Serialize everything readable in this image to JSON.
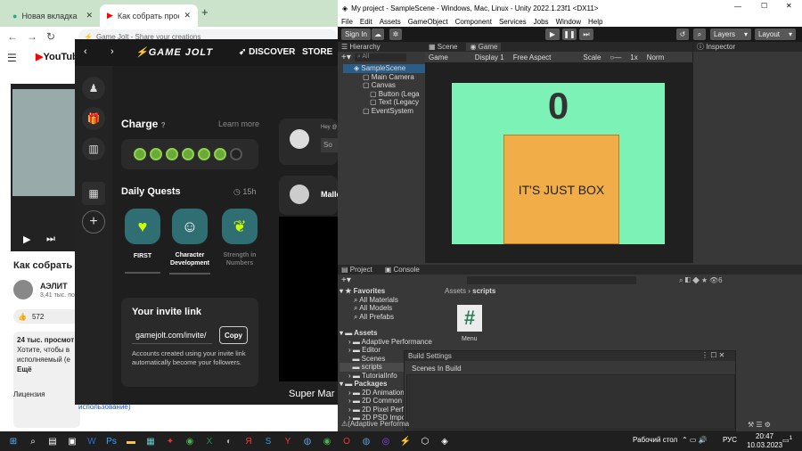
{
  "chrome": {
    "tabs": [
      {
        "label": "Новая вкладка"
      },
      {
        "label": "Как собрать проект U"
      }
    ],
    "address": "Game Jolt - Share your creations",
    "yt": {
      "logo": "YouTube",
      "video_title": "Как собрать п",
      "channel": "АЭЛИТ",
      "subs": "3,41 тыс. по",
      "likes": "572",
      "desc1": "24 тыс. просмот",
      "desc2": "Хотите, чтобы в",
      "desc3": "исполняемый (е",
      "desc4": "Ещё",
      "license": "Лицензия",
      "footer": "использование)"
    }
  },
  "gamejolt": {
    "logo": "GAME JOLT",
    "discover": "DISCOVER",
    "store": "STORE",
    "charge_title": "Charge",
    "learn_more": "Learn more",
    "daily_title": "Daily Quests",
    "daily_timer": "15h",
    "quests": [
      {
        "label": "FIRST"
      },
      {
        "label": "Character Development"
      },
      {
        "label": "Strength in Numbers"
      }
    ],
    "invite_title": "Your invite link",
    "invite_link": "gamejolt.com/invite/",
    "copy": "Copy",
    "invite_desc": "Accounts created using your invite link automatically become your followers.",
    "right_snippet1": "Hey @",
    "right_snippet2": "So",
    "right_name": "Malle",
    "right_bottom": "Super Mar"
  },
  "unity": {
    "title": "My project - SampleScene - Windows, Mac, Linux - Unity 2022.1.23f1 <DX11>",
    "menu": [
      "File",
      "Edit",
      "Assets",
      "GameObject",
      "Component",
      "Services",
      "Jobs",
      "Window",
      "Help"
    ],
    "sign_in": "Sign In",
    "layers": "Layers",
    "layout": "Layout",
    "hierarchy_tab": "Hierarchy",
    "scene_tab": "Scene",
    "game_tab": "Game",
    "inspector_tab": "Inspector",
    "search_all": "All",
    "hierarchy": [
      "SampleScene",
      "Main Camera",
      "Canvas",
      "Button (Lega",
      "Text (Legacy",
      "EventSystem"
    ],
    "game_bar": {
      "mode": "Game",
      "display": "Display 1",
      "aspect": "Free Aspect",
      "scale": "Scale",
      "scale_val": "1x",
      "norm": "Norm"
    },
    "score": "0",
    "box_text": "IT'S JUST BOX",
    "project_tab": "Project",
    "console_tab": "Console",
    "favorites": "Favorites",
    "fav_items": [
      "All Materials",
      "All Models",
      "All Prefabs"
    ],
    "assets": "Assets",
    "asset_items": [
      "Adaptive Performance",
      "Editor",
      "Scenes",
      "scripts",
      "TutorialInfo"
    ],
    "packages": "Packages",
    "package_items": [
      "2D Animation",
      "2D Common",
      "2D Pixel Perfe",
      "2D PSD Impor"
    ],
    "breadcrumb_assets": "Assets",
    "breadcrumb_scripts": "scripts",
    "script_name": "Menu",
    "build_settings": "Build Settings",
    "scenes_in_build": "Scenes In Build",
    "status": "(Adaptive Performa",
    "count": "6"
  },
  "taskbar": {
    "desktop": "Рабочий стол",
    "lang": "РУС",
    "time": "20:47",
    "date": "10.03.2023",
    "notif": "1"
  }
}
